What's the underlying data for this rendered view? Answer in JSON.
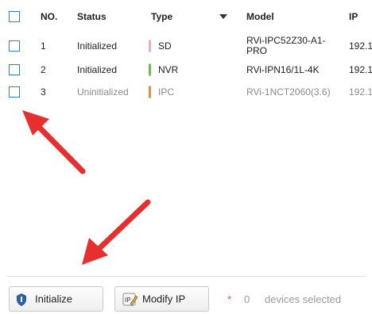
{
  "table": {
    "columns": {
      "no": "NO.",
      "status": "Status",
      "type": "Type",
      "model": "Model",
      "ip": "IP"
    },
    "rows": [
      {
        "no": "1",
        "status": "Initialized",
        "type": "SD",
        "type_color": "#f2a9c8",
        "model_line1": "RVi-IPC52Z30-A1-",
        "model_line2": "PRO",
        "ip": "192.1"
      },
      {
        "no": "2",
        "status": "Initialized",
        "type": "NVR",
        "type_color": "#6cc04a",
        "model": "RVi-IPN16/1L-4K",
        "ip": "192.1"
      },
      {
        "no": "3",
        "status": "Uninitialized",
        "type": "IPC",
        "type_color": "#f08a3c",
        "model": "RVi-1NCT2060(3.6)",
        "ip": "192.1"
      }
    ]
  },
  "footer": {
    "initialize_label": "Initialize",
    "modify_ip_label": "Modify IP",
    "star": "*",
    "selected_count": "0",
    "selected_text": "devices selected"
  },
  "colors": {
    "accent": "#2f7fcf",
    "arrow": "#e5302f"
  },
  "icons": {
    "initialize": "shield-icon",
    "modify_ip": "ip-edit-icon",
    "sort": "sort-down-icon",
    "pointer": "red-arrow-icon"
  }
}
